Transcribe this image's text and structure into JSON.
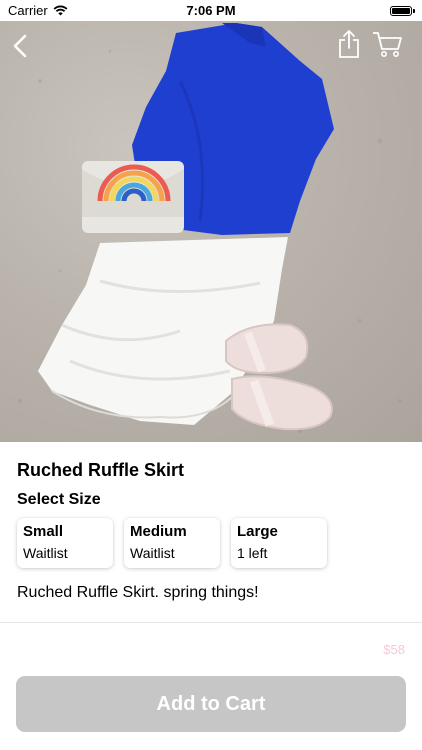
{
  "status_bar": {
    "carrier": "Carrier",
    "time": "7:06 PM"
  },
  "nav": {
    "back_icon": "chevron-left-icon",
    "share_icon": "share-icon",
    "cart_icon": "cart-icon"
  },
  "product": {
    "title": "Ruched Ruffle Skirt",
    "select_size_label": "Select Size",
    "sizes": [
      {
        "name": "Small",
        "status": "Waitlist"
      },
      {
        "name": "Medium",
        "status": "Waitlist"
      },
      {
        "name": "Large",
        "status": "1 left"
      }
    ],
    "description": "Ruched Ruffle Skirt. spring things!",
    "price": "$58"
  },
  "actions": {
    "add_to_cart_label": "Add to Cart"
  },
  "colors": {
    "button_bg": "#c6c6c6",
    "price_color": "#f6c7dc",
    "top_blue": "#1f3fd1"
  }
}
